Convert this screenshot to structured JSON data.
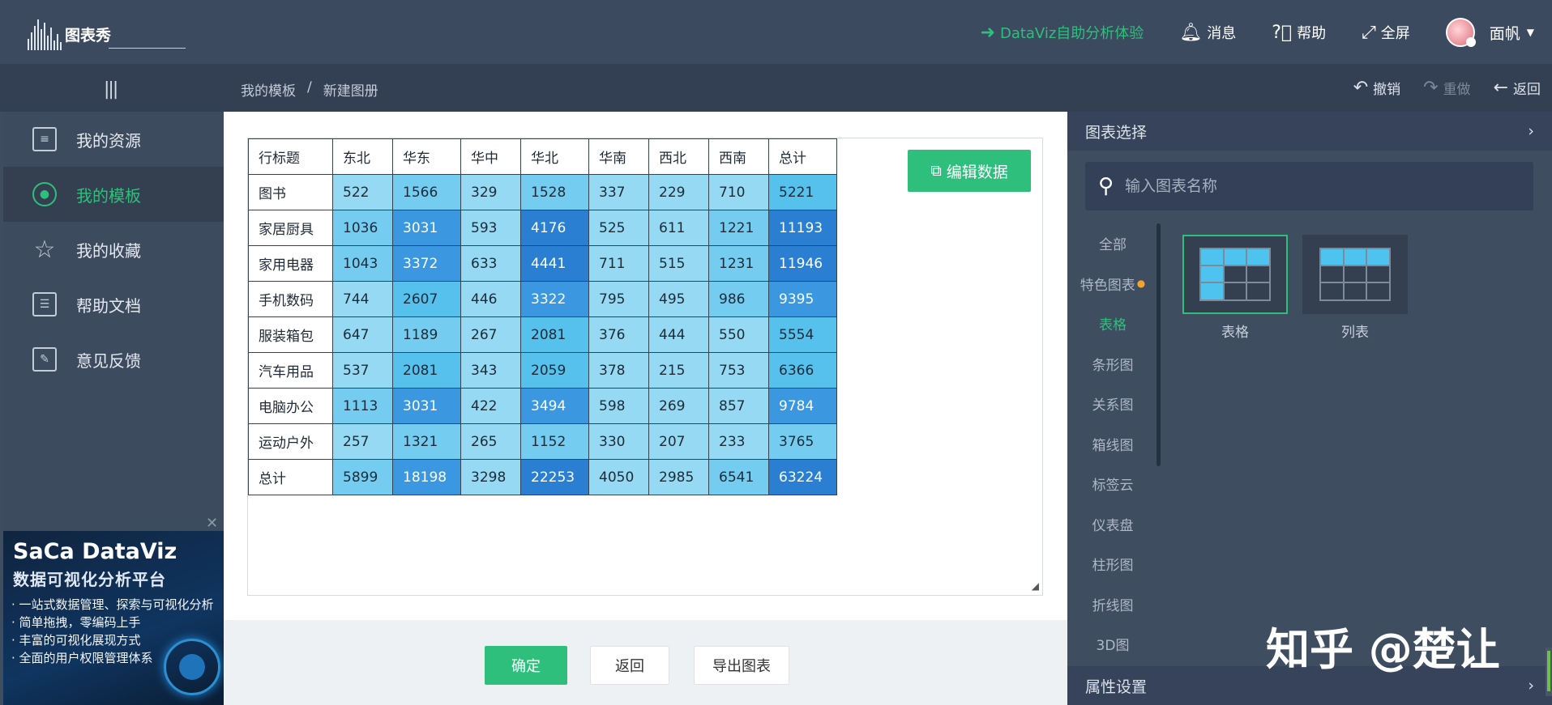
{
  "header": {
    "logo_text": "图表秀",
    "dataviz_link": "DataViz自助分析体验",
    "messages": "消息",
    "help": "帮助",
    "fullscreen": "全屏",
    "username": "面帆"
  },
  "subbar": {
    "breadcrumb": [
      "我的模板",
      "/",
      "新建图册"
    ],
    "undo": "撤销",
    "redo": "重做",
    "back": "返回"
  },
  "sidebar": {
    "items": [
      {
        "label": "我的资源"
      },
      {
        "label": "我的模板"
      },
      {
        "label": "我的收藏"
      },
      {
        "label": "帮助文档"
      },
      {
        "label": "意见反馈"
      }
    ]
  },
  "promo": {
    "title": "SaCa DataViz",
    "subtitle": "数据可视化分析平台",
    "bullets": [
      "一站式数据管理、探索与可视化分析",
      "简单拖拽，零编码上手",
      "丰富的可视化展现方式",
      "全面的用户权限管理体系"
    ]
  },
  "table": {
    "headers": [
      "行标题",
      "东北",
      "华东",
      "华中",
      "华北",
      "华南",
      "西北",
      "西南",
      "总计"
    ],
    "rows": [
      [
        "图书",
        "522",
        "1566",
        "329",
        "1528",
        "337",
        "229",
        "710",
        "5221"
      ],
      [
        "家居厨具",
        "1036",
        "3031",
        "593",
        "4176",
        "525",
        "611",
        "1221",
        "11193"
      ],
      [
        "家用电器",
        "1043",
        "3372",
        "633",
        "4441",
        "711",
        "515",
        "1231",
        "11946"
      ],
      [
        "手机数码",
        "744",
        "2607",
        "446",
        "3322",
        "795",
        "495",
        "986",
        "9395"
      ],
      [
        "服装箱包",
        "647",
        "1189",
        "267",
        "2081",
        "376",
        "444",
        "550",
        "5554"
      ],
      [
        "汽车用品",
        "537",
        "2081",
        "343",
        "2059",
        "378",
        "215",
        "753",
        "6366"
      ],
      [
        "电脑办公",
        "1113",
        "3031",
        "422",
        "3494",
        "598",
        "269",
        "857",
        "9784"
      ],
      [
        "运动户外",
        "257",
        "1321",
        "265",
        "1152",
        "330",
        "207",
        "233",
        "3765"
      ],
      [
        "总计",
        "5899",
        "18198",
        "3298",
        "22253",
        "4050",
        "2985",
        "6541",
        "63224"
      ]
    ]
  },
  "editor": {
    "edit_data": "编辑数据",
    "confirm": "确定",
    "return": "返回",
    "export": "导出图表"
  },
  "right_panel": {
    "title": "图表选择",
    "search_placeholder": "输入图表名称",
    "categories": [
      "全部",
      "特色图表",
      "表格",
      "条形图",
      "关系图",
      "箱线图",
      "标签云",
      "仪表盘",
      "柱形图",
      "折线图",
      "3D图"
    ],
    "active_category": "表格",
    "chart_types": [
      {
        "label": "表格",
        "active": true
      },
      {
        "label": "列表",
        "active": false
      }
    ],
    "footer": "属性设置"
  },
  "watermark": "知乎 @楚让",
  "colors": {
    "accent": "#2fbf7d",
    "topbar": "#3c4a5f",
    "cell_light": "#8fd6f2",
    "cell_mid": "#56c1ec",
    "cell_dark": "#2a7fd3"
  }
}
